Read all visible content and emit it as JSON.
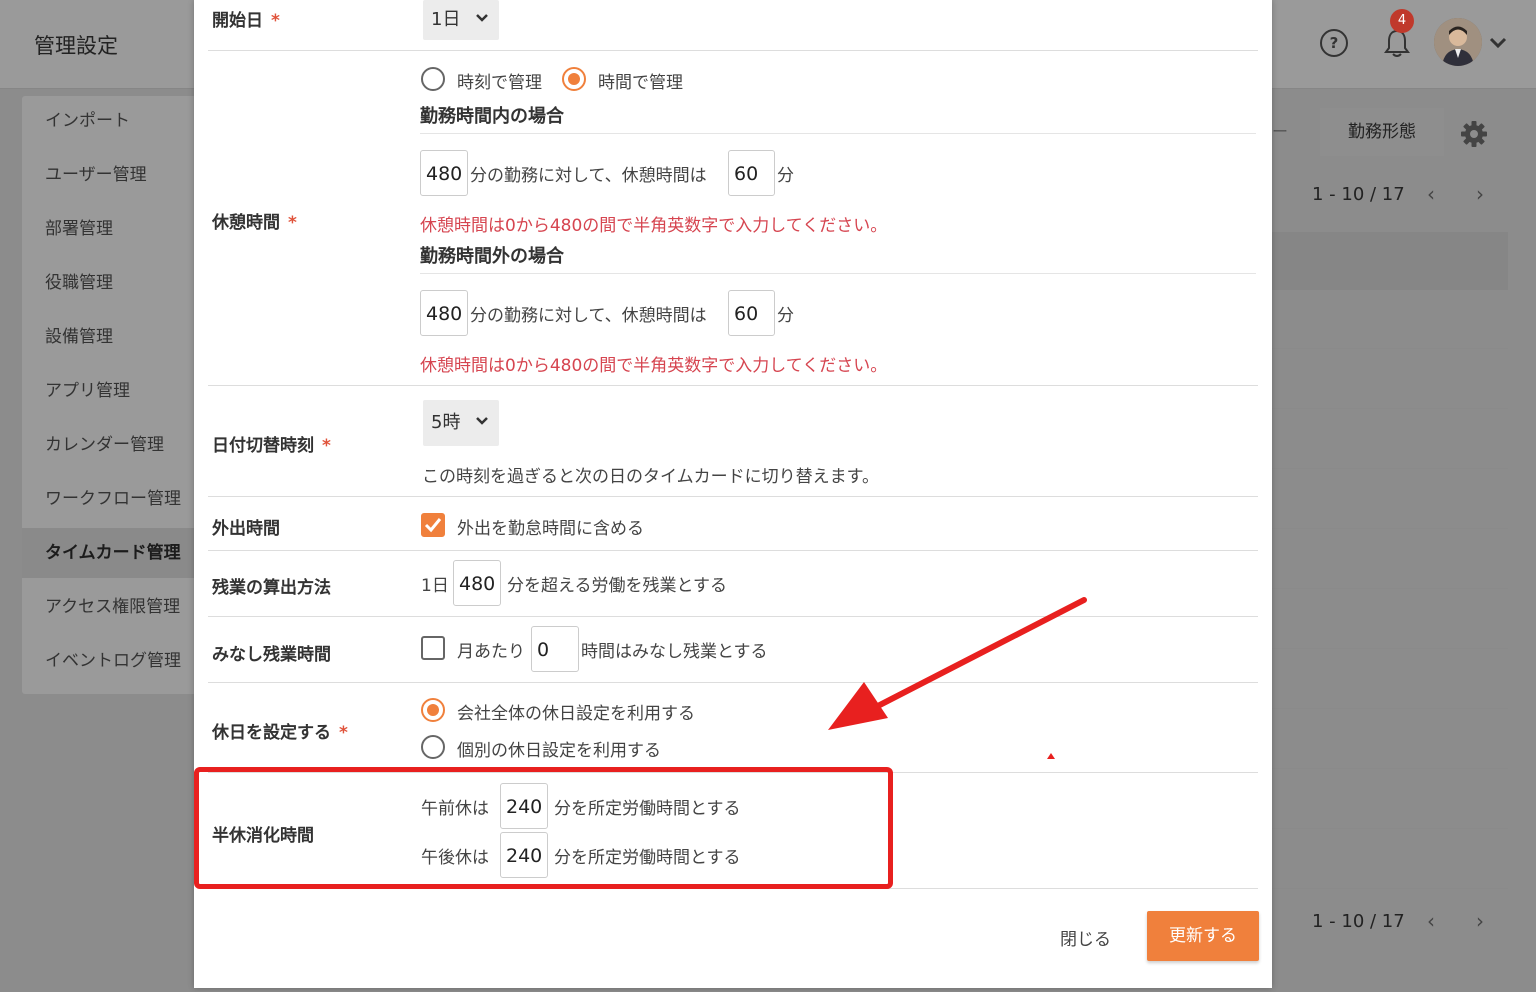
{
  "app": {
    "title": "管理設定",
    "notification_count": "4"
  },
  "sidebar": {
    "items": [
      {
        "label": "インポート"
      },
      {
        "label": "ユーザー管理"
      },
      {
        "label": "部署管理"
      },
      {
        "label": "役職管理"
      },
      {
        "label": "設備管理"
      },
      {
        "label": "アプリ管理"
      },
      {
        "label": "カレンダー管理"
      },
      {
        "label": "ワークフロー管理"
      },
      {
        "label": "タイムカード管理"
      },
      {
        "label": "アクセス権限管理"
      },
      {
        "label": "イベントログ管理"
      }
    ]
  },
  "background": {
    "tab_prev_partial": "ー",
    "tab_active": "勤務形態",
    "pagination_top": "1 - 10 / 17",
    "pagination_bottom": "1 - 10 / 17"
  },
  "form": {
    "required_mark": "*",
    "start_day": {
      "label": "開始日",
      "value": "1日"
    },
    "break": {
      "label": "休憩時間",
      "mode_options": [
        {
          "label": "時刻で管理",
          "selected": false
        },
        {
          "label": "時間で管理",
          "selected": true
        }
      ],
      "within": {
        "subtitle": "勤務時間内の場合",
        "work_minutes": "480",
        "text_mid": "分の勤務に対して、休憩時間は",
        "break_minutes": "60",
        "unit": "分",
        "error": "休憩時間は0から480の間で半角英数字で入力してください。"
      },
      "outside": {
        "subtitle": "勤務時間外の場合",
        "work_minutes": "480",
        "text_mid": "分の勤務に対して、休憩時間は",
        "break_minutes": "60",
        "unit": "分",
        "error": "休憩時間は0から480の間で半角英数字で入力してください。"
      }
    },
    "day_switch": {
      "label": "日付切替時刻",
      "value": "5時",
      "help": "この時刻を過ぎると次の日のタイムカードに切り替えます。"
    },
    "outing": {
      "label": "外出時間",
      "checkbox_label": "外出を勤怠時間に含める",
      "checked": true
    },
    "overtime_calc": {
      "label": "残業の算出方法",
      "prefix": "1日",
      "value": "480",
      "suffix": "分を超える労働を残業とする"
    },
    "deemed_overtime": {
      "label": "みなし残業時間",
      "prefix": "月あたり",
      "value": "0",
      "suffix": "時間はみなし残業とする",
      "checked": false
    },
    "holiday": {
      "label": "休日を設定する",
      "options": [
        {
          "label": "会社全体の休日設定を利用する",
          "selected": true
        },
        {
          "label": "個別の休日設定を利用する",
          "selected": false
        }
      ]
    },
    "half_day": {
      "label": "半休消化時間",
      "am": {
        "prefix": "午前休は",
        "value": "240",
        "suffix": "分を所定労働時間とする"
      },
      "pm": {
        "prefix": "午後休は",
        "value": "240",
        "suffix": "分を所定労働時間とする"
      }
    },
    "close_label": "閉じる",
    "update_label": "更新する"
  },
  "colors": {
    "accent": "#f0803c",
    "error": "#d64550",
    "highlight": "#e8201f"
  }
}
